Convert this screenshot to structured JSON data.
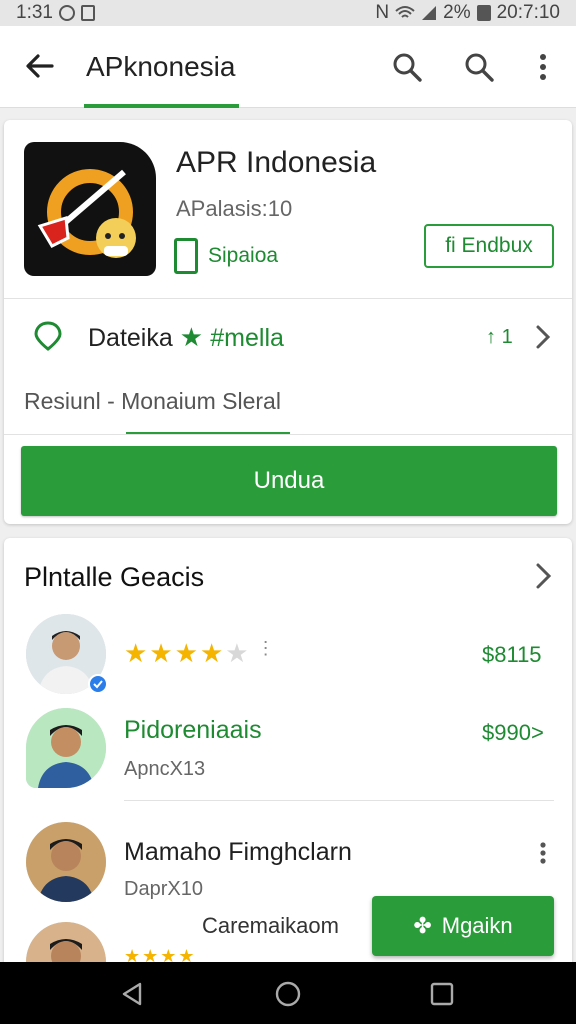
{
  "status_bar": {
    "time": "1:31",
    "right_text": "2%",
    "clock": "20:7:10"
  },
  "app_bar": {
    "title": "APknonesia"
  },
  "app": {
    "name": "APR Indonesia",
    "developer": "APalasis:10",
    "tag_label": "Sipaioa",
    "outline_button": "fi Endbux",
    "rating_label": "Dateika",
    "rating_suffix": "#mella",
    "rating_count": "1",
    "subtitle": "Resiunl - Monaium Sleral",
    "primary_button": "Undua"
  },
  "reviews_section": {
    "title": "Plntalle Geacis",
    "items": [
      {
        "stars": 3.5,
        "price": "$8115"
      },
      {
        "name": "Pidoreniaais",
        "sub": "ApncX13",
        "price": "$990>"
      },
      {
        "name": "Mamaho Fimghclarn",
        "sub": "DaprX10"
      }
    ],
    "caption": "Caremaikaom",
    "fab_label": "Mgaikn"
  },
  "colors": {
    "accent": "#2a9d3a",
    "accent_text": "#1e8a32",
    "star": "#f4b400"
  }
}
